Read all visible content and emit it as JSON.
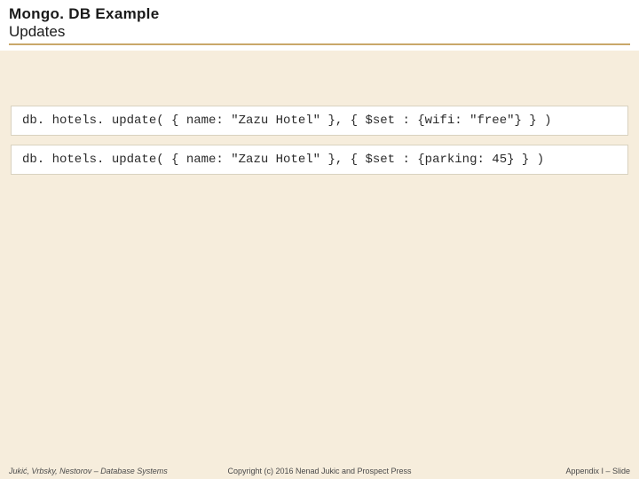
{
  "header": {
    "title_line1": "Mongo. DB Example",
    "title_line2": "Updates"
  },
  "code_lines": [
    "db. hotels. update( { name: \"Zazu Hotel\" }, { $set : {wifi: \"free\"} } )",
    "db. hotels. update( { name: \"Zazu Hotel\" }, { $set : {parking: 45} } )"
  ],
  "footer": {
    "left": "Jukić, Vrbsky, Nestorov – Database Systems",
    "center": "Copyright (c) 2016 Nenad Jukic and Prospect Press",
    "right": "Appendix I – Slide"
  }
}
